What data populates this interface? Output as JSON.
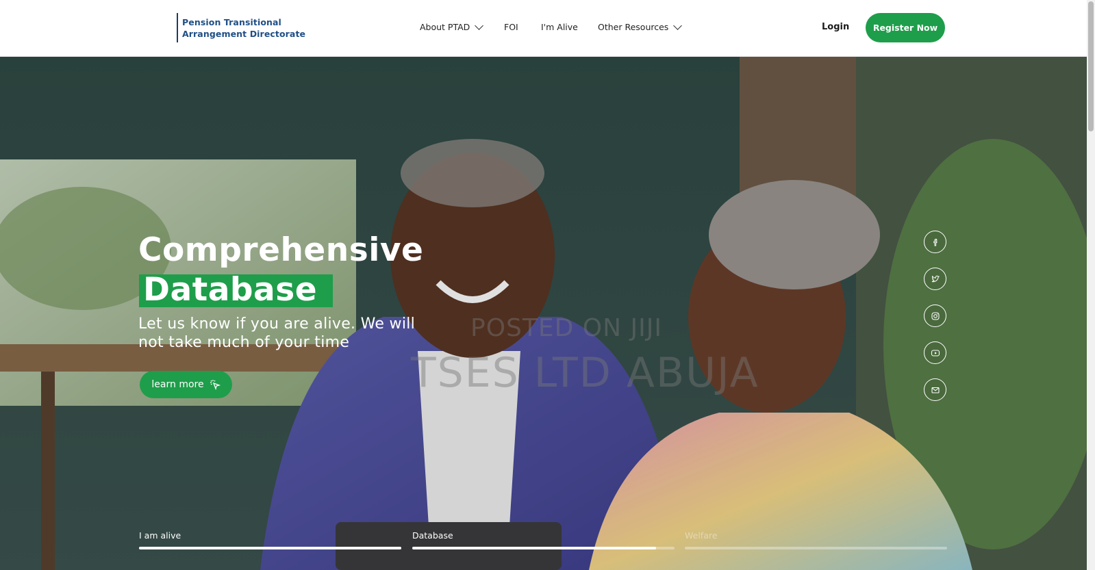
{
  "logo": {
    "line1": "Pension Transitional",
    "line2": "Arrangement Directorate"
  },
  "nav": {
    "items": [
      {
        "label": "About PTAD",
        "has_dropdown": true
      },
      {
        "label": "FOI",
        "has_dropdown": false
      },
      {
        "label": "I'm Alive",
        "has_dropdown": false
      },
      {
        "label": "Other Resources",
        "has_dropdown": true
      }
    ],
    "login_label": "Login",
    "register_label": "Register Now"
  },
  "hero": {
    "headline_line1": "Comprehensive",
    "headline_highlight": "Database",
    "subtext": "Let us know if you are alive. We will not take much of your time",
    "cta_label": "learn more",
    "watermark_line1": "POSTED ON JIJI",
    "watermark_line2": "TSES LTD ABUJA"
  },
  "social": [
    "facebook-icon",
    "twitter-icon",
    "instagram-icon",
    "youtube-icon",
    "mail-icon"
  ],
  "tabs": [
    {
      "label": "I am alive",
      "progress": 1.0
    },
    {
      "label": "Database",
      "progress": 0.93
    },
    {
      "label": "Welfare",
      "progress": 0.0
    }
  ],
  "colors": {
    "accent": "#1e9e4a",
    "logo": "#1f4f86"
  }
}
